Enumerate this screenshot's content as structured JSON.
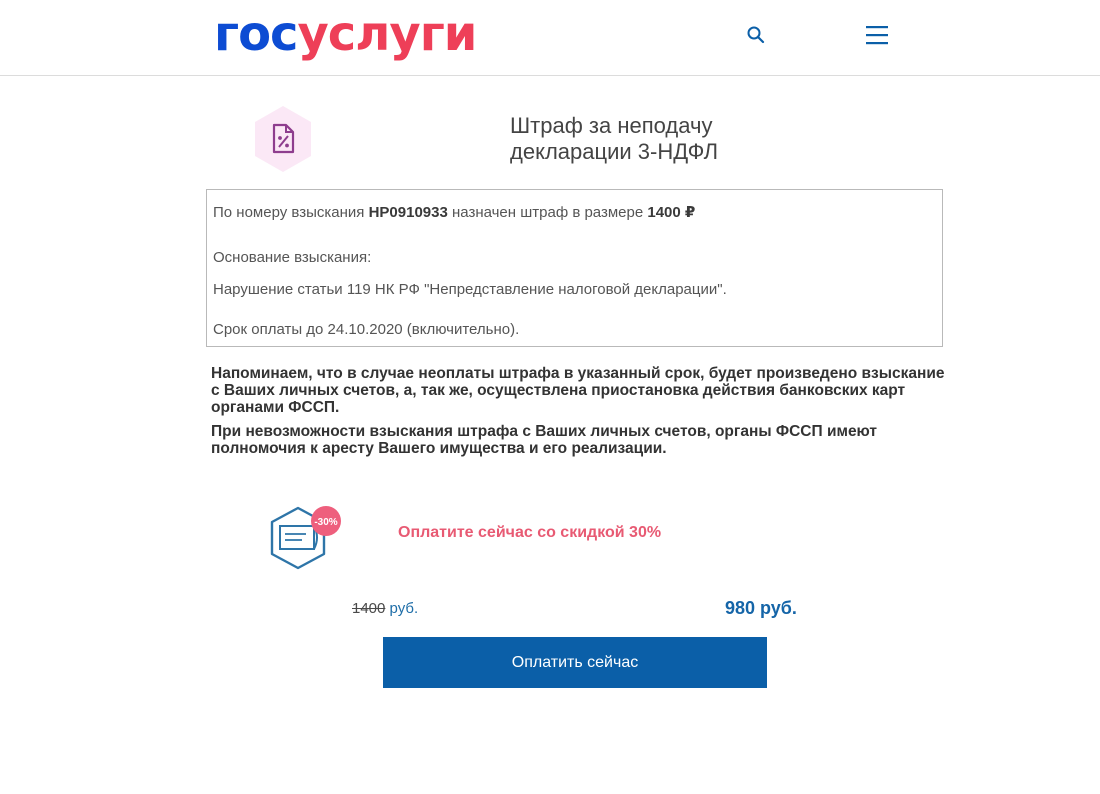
{
  "header": {
    "logo_part1": "гос",
    "logo_part2": "услуги",
    "search_icon": "search-icon",
    "menu_icon": "menu-icon"
  },
  "title": {
    "line1": "Штраф за неподачу",
    "line2": "декларации 3-НДФЛ",
    "icon": "percent-document-icon"
  },
  "info": {
    "number_prefix": "По номеру взыскания",
    "number": "НР0910933",
    "amount_prefix": "назначен штраф в размере",
    "amount": "1400 ₽",
    "basis_label": "Основание взыскания:",
    "basis_text": "Нарушение статьи 119 НК РФ \"Непредставление налоговой декларации\".",
    "deadline": "Срок оплаты до 24.10.2020 (включительно)."
  },
  "warnings": [
    "Напоминаем, что в случае неоплаты штрафа в указанный срок, будет произведено взыскание с Ваших личных счетов, а, так же, осуществлена приостановка действия банковских карт органами ФССП.",
    "При невозможности взыскания штрафа с Ваших личных счетов, органы ФССП имеют полномочия к аресту Вашего имущества и его реализации."
  ],
  "promo": {
    "icon": "discount-payment-icon",
    "badge": "-30%",
    "text": "Оплатите сейчас со скидкой 30%",
    "old_price": "1400",
    "old_price_unit": " руб.",
    "new_price": "980 руб.",
    "button_label": "Оплатить сейчас"
  },
  "colors": {
    "logo_blue": "#0d4cd3",
    "logo_red": "#ee3f58",
    "promo_pink": "#e85a73",
    "button_blue": "#0b5fa8",
    "price_blue": "#1565a8"
  }
}
